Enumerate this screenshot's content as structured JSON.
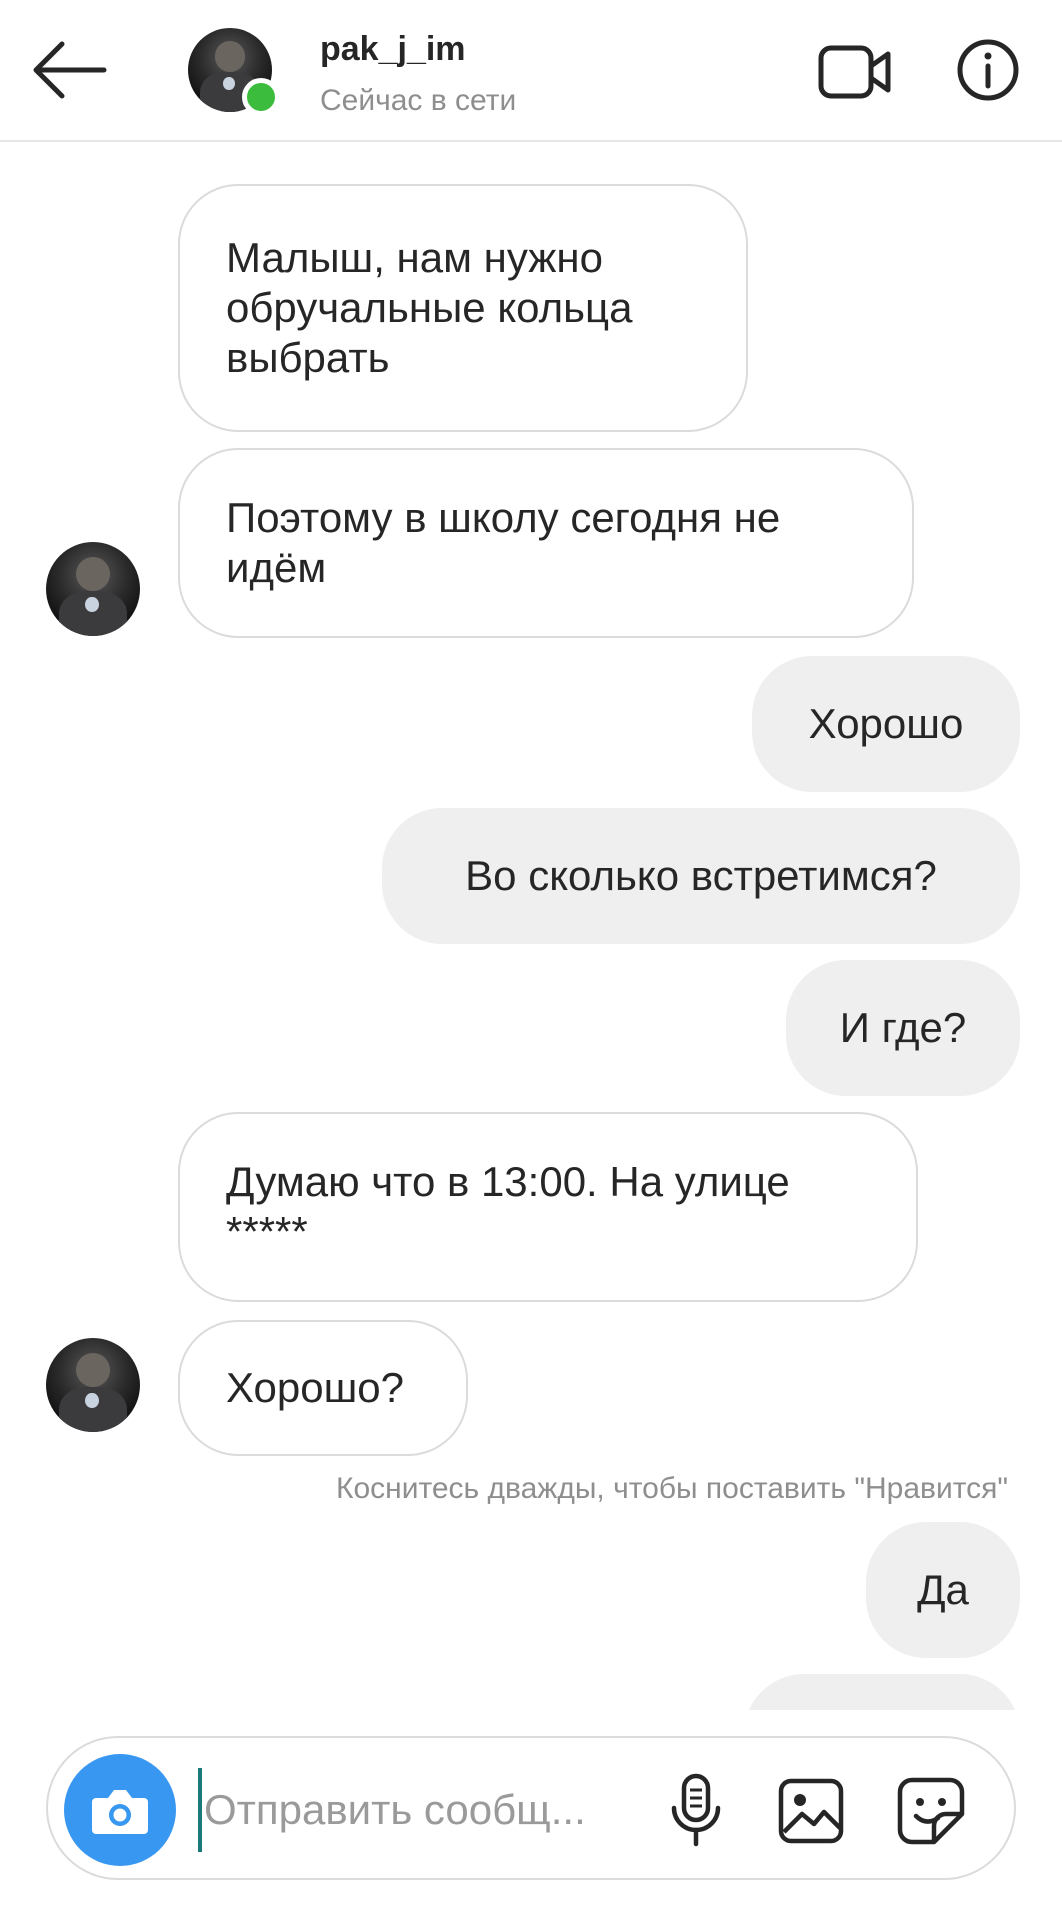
{
  "header": {
    "username": "pak_j_im",
    "status": "Сейчас в сети",
    "icons": {
      "back": "arrow-left-icon",
      "video": "video-camera-icon",
      "info": "info-icon"
    }
  },
  "messages": [
    {
      "from": "them",
      "lines": [
        "Малыш, нам нужно",
        "обручальные кольца",
        "выбрать"
      ]
    },
    {
      "from": "them",
      "lines": [
        "Поэтому в школу сегодня не",
        "идём"
      ]
    },
    {
      "from": "me",
      "lines": [
        "Хорошо"
      ]
    },
    {
      "from": "me",
      "lines": [
        "Во сколько встретимся?"
      ]
    },
    {
      "from": "me",
      "lines": [
        "И где?"
      ]
    },
    {
      "from": "them",
      "lines": [
        "Думаю что в 13:00. На улице",
        "*****"
      ]
    },
    {
      "from": "them",
      "lines": [
        "Хорошо?"
      ]
    },
    {
      "from": "me",
      "lines": [
        "Да"
      ]
    }
  ],
  "hint": "Коснитесь дважды, чтобы поставить \"Нравится\"",
  "composer": {
    "placeholder": "Отправить сообщ...",
    "icons": {
      "camera": "camera-icon",
      "mic": "microphone-icon",
      "gallery": "image-icon",
      "sticker": "sticker-icon"
    },
    "accent": "#3897f0"
  },
  "colors": {
    "online": "#3cbc3c",
    "outgoing_bubble": "#efefef",
    "incoming_border": "#dbdbdb"
  }
}
